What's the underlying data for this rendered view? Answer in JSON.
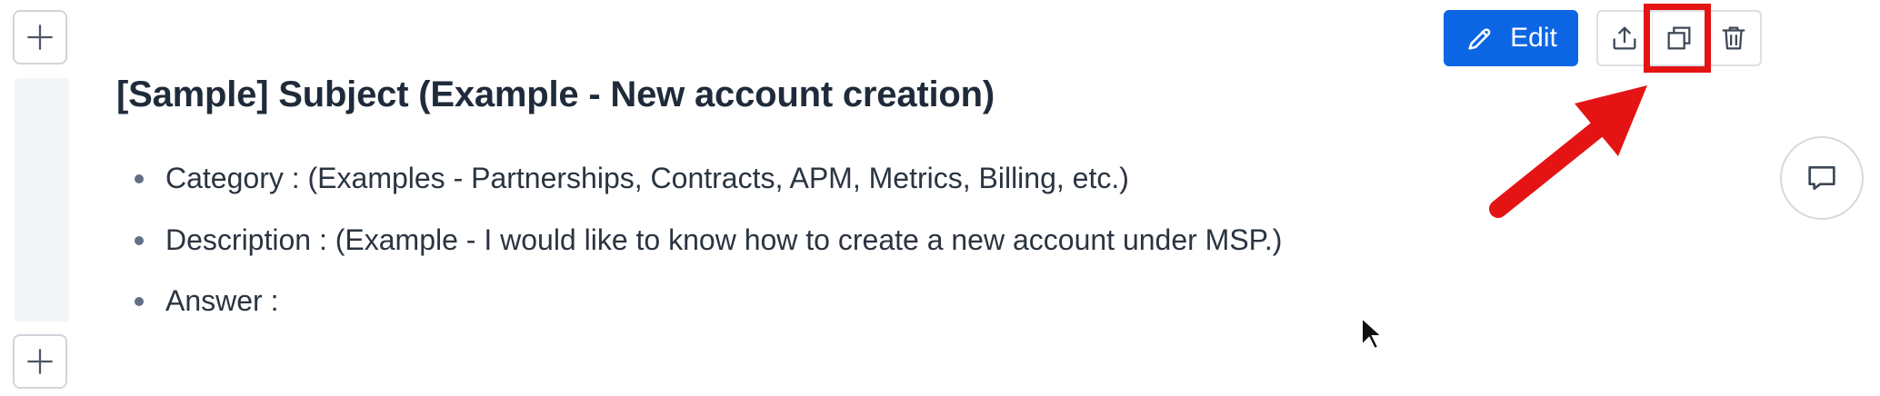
{
  "toolbar": {
    "edit_label": "Edit",
    "icons": [
      "pencil-icon",
      "share-icon",
      "duplicate-icon",
      "trash-icon"
    ]
  },
  "block": {
    "title": "[Sample] Subject (Example - New account creation)",
    "items": [
      "Category : (Examples - Partnerships, Contracts, APM, Metrics, Billing, etc.)",
      "Description : (Example - I would like to know how to create a new account under MSP.)",
      "Answer :"
    ]
  },
  "annotations": {
    "highlight_color": "#e41414",
    "highlight_target": "duplicate-icon"
  },
  "colors": {
    "primary_button": "#0c66e4",
    "text": "#1f2b3a"
  }
}
